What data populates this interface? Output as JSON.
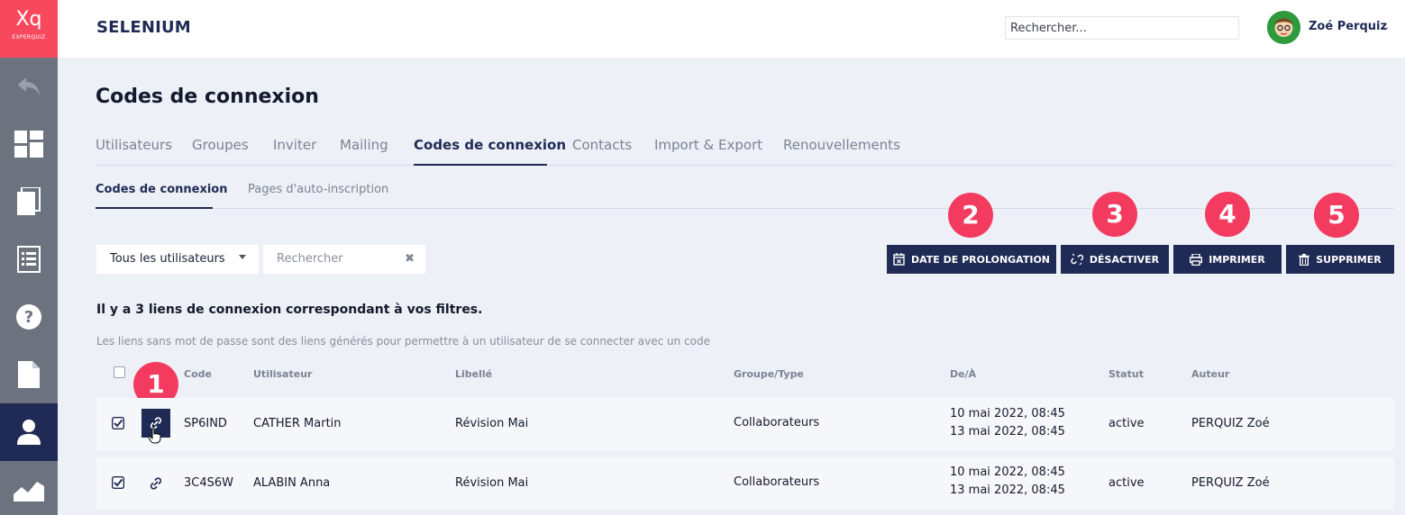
{
  "logo": {
    "text": "Xq",
    "subtext": "EXPERQUIZ"
  },
  "sidebar": {
    "items": [
      {
        "icon": "back-icon"
      },
      {
        "icon": "dashboard-icon"
      },
      {
        "icon": "documents-icon"
      },
      {
        "icon": "list-icon"
      },
      {
        "icon": "help-icon"
      },
      {
        "icon": "file-icon"
      },
      {
        "icon": "users-icon",
        "active": true
      },
      {
        "icon": "stats-icon"
      }
    ]
  },
  "header": {
    "app_title": "SELENIUM",
    "search_placeholder": "Rechercher...",
    "user_name": "Zoé Perquiz",
    "caret": "⌄"
  },
  "page_title": "Codes de connexion",
  "tabs": [
    "Utilisateurs",
    "Groupes",
    "Inviter",
    "Mailing",
    "Codes de connexion",
    "Contacts",
    "Import & Export",
    "Renouvellements"
  ],
  "active_tab": "Codes de connexion",
  "subtabs": [
    "Codes de connexion",
    "Pages d'auto-inscription"
  ],
  "filters": {
    "select_value": "Tous les utilisateurs",
    "search_placeholder": "Rechercher",
    "clear": "✖"
  },
  "actions": {
    "prolongation": "DATE DE PROLONGATION",
    "deactivate": "DÉSACTIVER",
    "print": "IMPRIMER",
    "delete": "SUPPRIMER"
  },
  "badges": [
    "1",
    "2",
    "3",
    "4",
    "5"
  ],
  "result_text": "Il y a 3 liens de connexion correspondant à vos filtres.",
  "hint_text": "Les liens sans mot de passe sont des liens générés pour permettre à un utilisateur de se connecter avec un code",
  "table": {
    "headers": {
      "code": "Code",
      "user": "Utilisateur",
      "label": "Libellé",
      "group": "Groupe/Type",
      "dates": "De/À",
      "status": "Statut",
      "author": "Auteur"
    },
    "rows": [
      {
        "checked": true,
        "code": "SP6IND",
        "user": "CATHER Martin",
        "label": "Révision Mai",
        "group": "Collaborateurs",
        "from": "10 mai 2022, 08:45",
        "to": "13 mai 2022, 08:45",
        "status": "active",
        "author": "PERQUIZ Zoé"
      },
      {
        "checked": true,
        "code": "3C4S6W",
        "user": "ALABIN Anna",
        "label": "Révision Mai",
        "group": "Collaborateurs",
        "from": "10 mai 2022, 08:45",
        "to": "13 mai 2022, 08:45",
        "status": "active",
        "author": "PERQUIZ Zoé"
      }
    ]
  },
  "colors": {
    "brand": "#f8485e",
    "navy": "#1f2b55",
    "sidebar": "#6c737f",
    "badge": "#f23b5f",
    "background": "#edf0f6"
  }
}
